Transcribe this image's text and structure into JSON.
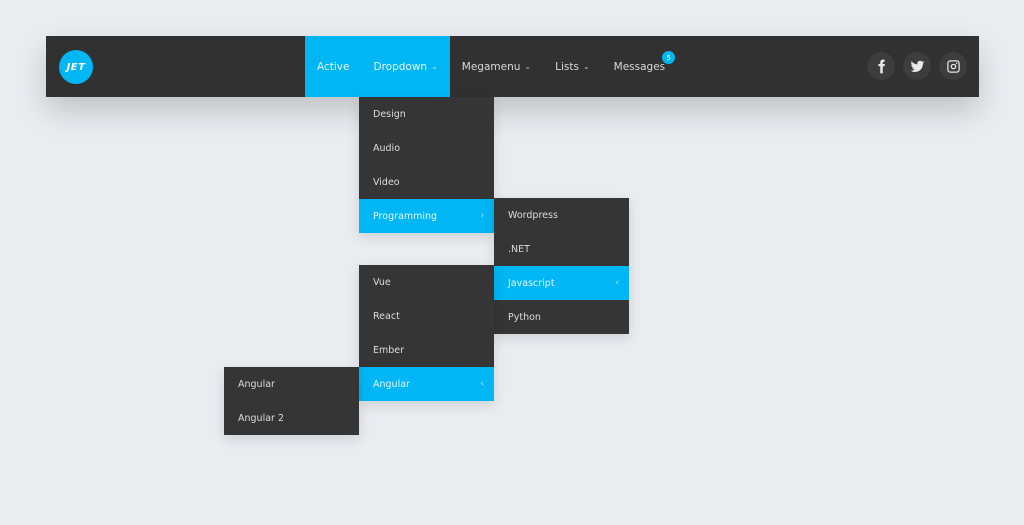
{
  "brand": {
    "logo_text": "JET",
    "accent": "#00b6f5"
  },
  "nav": {
    "items": [
      {
        "label": "Active",
        "has_chevron": false
      },
      {
        "label": "Dropdown",
        "has_chevron": true
      },
      {
        "label": "Megamenu",
        "has_chevron": true
      },
      {
        "label": "Lists",
        "has_chevron": true
      },
      {
        "label": "Messages",
        "badge": "5"
      }
    ],
    "chevron": "⌄"
  },
  "socials": [
    "facebook-icon",
    "twitter-icon",
    "instagram-icon"
  ],
  "menus": {
    "dropdown": [
      {
        "label": "Design"
      },
      {
        "label": "Audio"
      },
      {
        "label": "Video"
      },
      {
        "label": "Programming",
        "arrow": "›",
        "highlighted": true
      }
    ],
    "programming": [
      {
        "label": "Wordpress"
      },
      {
        "label": ".NET"
      },
      {
        "label": "Javascript",
        "arrow": "‹",
        "highlighted": true
      },
      {
        "label": "Python"
      }
    ],
    "javascript": [
      {
        "label": "Vue"
      },
      {
        "label": "React"
      },
      {
        "label": "Ember"
      },
      {
        "label": "Angular",
        "arrow": "‹",
        "highlighted": true
      }
    ],
    "angular": [
      {
        "label": "Angular"
      },
      {
        "label": "Angular 2"
      }
    ]
  }
}
